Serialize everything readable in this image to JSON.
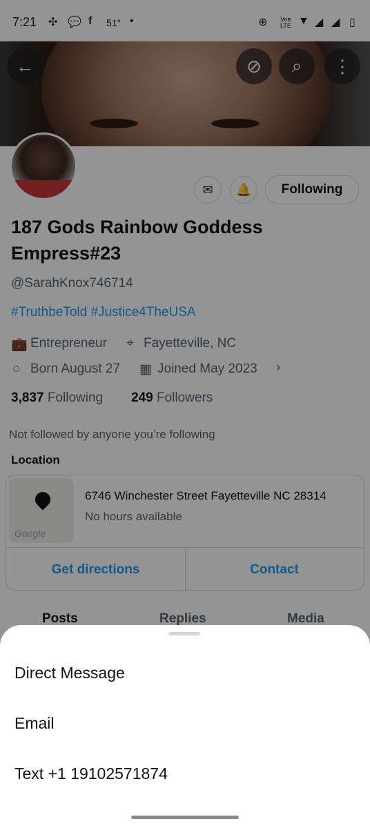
{
  "status_bar": {
    "time": "7:21",
    "temperature": "51°",
    "dot": "•",
    "network": "Voʙ LTE"
  },
  "profile": {
    "name": "187 Gods Rainbow Goddess Empress#23",
    "handle": "@SarahKnox746714",
    "bio_tags": "#TruthbeTold #Justice4TheUSA",
    "occupation": "Entrepreneur",
    "location": "Fayetteville, NC",
    "birthday": "Born August 27",
    "joined": "Joined May 2023",
    "following_count": "3,837",
    "following_label": "Following",
    "followers_count": "249",
    "followers_label": "Followers",
    "not_followed": "Not followed by anyone you’re following",
    "follow_button": "Following"
  },
  "location_card": {
    "section_label": "Location",
    "address": "6746 Winchester Street Fayetteville NC 28314",
    "hours": "No hours available",
    "map_watermark": "Google",
    "directions_button": "Get directions",
    "contact_button": "Contact"
  },
  "tabs": [
    "Posts",
    "Replies",
    "Media"
  ],
  "sheet": {
    "items": [
      "Direct Message",
      "Email",
      "Text +1 19102571874"
    ]
  },
  "colors": {
    "accent": "#1d9bf0",
    "text": "#0f1419",
    "secondary_text": "#536471"
  }
}
